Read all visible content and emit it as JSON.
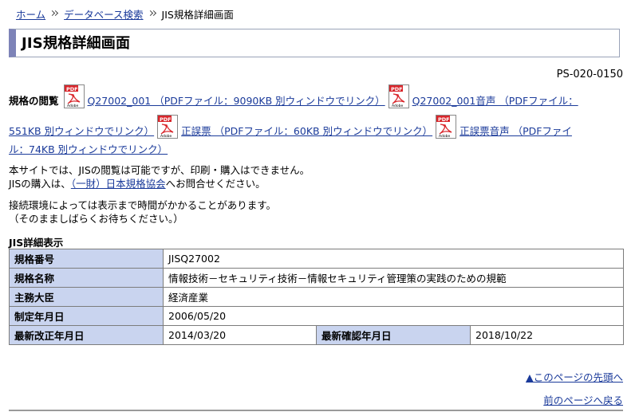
{
  "breadcrumb": {
    "home": "ホーム",
    "search": "データベース検索",
    "current": "JIS規格詳細画面"
  },
  "title": "JIS規格詳細画面",
  "doc_code": "PS-020-0150",
  "viewing": {
    "label": "規格の閲覧",
    "icon_text": "PDF",
    "links": [
      "Q27002_001 （PDFファイル：9090KB 別ウィンドウでリンク）",
      "Q27002_001音声 （PDFファイル：",
      "551KB 別ウィンドウでリンク）",
      "正誤票 （PDFファイル：60KB 別ウィンドウでリンク）",
      "正誤票音声 （PDFファイ",
      "ル：74KB 別ウィンドウでリンク）"
    ]
  },
  "notice": {
    "line1": "本サイトでは、JISの閲覧は可能ですが、印刷・購入はできません。",
    "line2_pre": "JISの購入は、",
    "line2_link": "（一財）日本規格協会",
    "line2_post": "へお問合せください。",
    "line3": "接続環境によっては表示まで時間がかかることがあります。",
    "line4": "（そのまましばらくお待ちください。）"
  },
  "detail": {
    "section_title": "JIS詳細表示",
    "rows": [
      {
        "label": "規格番号",
        "value": "JISQ27002"
      },
      {
        "label": "規格名称",
        "value": "情報技術－セキュリティ技術－情報セキュリティ管理策の実践のための規範"
      },
      {
        "label": "主務大臣",
        "value": "経済産業"
      },
      {
        "label": "制定年月日",
        "value": "2006/05/20"
      }
    ],
    "last_row": {
      "label1": "最新改正年月日",
      "value1": "2014/03/20",
      "label2": "最新確認年月日",
      "value2": "2018/10/22"
    }
  },
  "links": {
    "pagetop": "▲このページの先頭へ",
    "back": "前のページへ戻る"
  },
  "colors": {
    "link": "#1a3a9a",
    "label_bg": "#c9d4ef",
    "title_accent": "#7d83b8",
    "pdf_red": "#d9262b"
  }
}
